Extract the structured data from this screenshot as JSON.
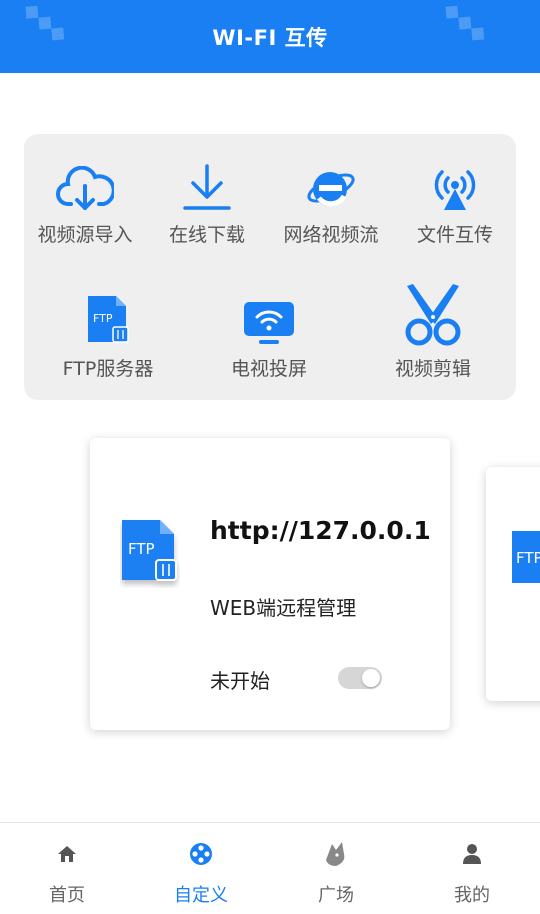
{
  "header": {
    "title": "WI-FI 互传"
  },
  "tools": [
    {
      "label": "视频源导入",
      "icon": "cloud-download-icon"
    },
    {
      "label": "在线下载",
      "icon": "download-arrow-icon"
    },
    {
      "label": "网络视频流",
      "icon": "browser-e-icon"
    },
    {
      "label": "文件互传",
      "icon": "wifi-broadcast-icon"
    },
    {
      "label": "FTP服务器",
      "icon": "ftp-file-icon"
    },
    {
      "label": "电视投屏",
      "icon": "tv-cast-icon"
    },
    {
      "label": "视频剪辑",
      "icon": "scissors-icon"
    }
  ],
  "ftp_card": {
    "icon_text": "FTP",
    "url": "http://127.0.0.1",
    "subtitle": "WEB端远程管理",
    "status": "未开始",
    "toggle_on": false
  },
  "ftp_card_peek": {
    "icon_text": "FTP"
  },
  "tabbar": [
    {
      "label": "首页",
      "icon": "home-icon",
      "active": false
    },
    {
      "label": "自定义",
      "icon": "film-reel-icon",
      "active": true
    },
    {
      "label": "广场",
      "icon": "fox-icon",
      "active": false
    },
    {
      "label": "我的",
      "icon": "user-icon",
      "active": false
    }
  ],
  "colors": {
    "accent": "#1a7ff2",
    "panel": "#efefef",
    "toggle_off": "#d6d6d6"
  }
}
